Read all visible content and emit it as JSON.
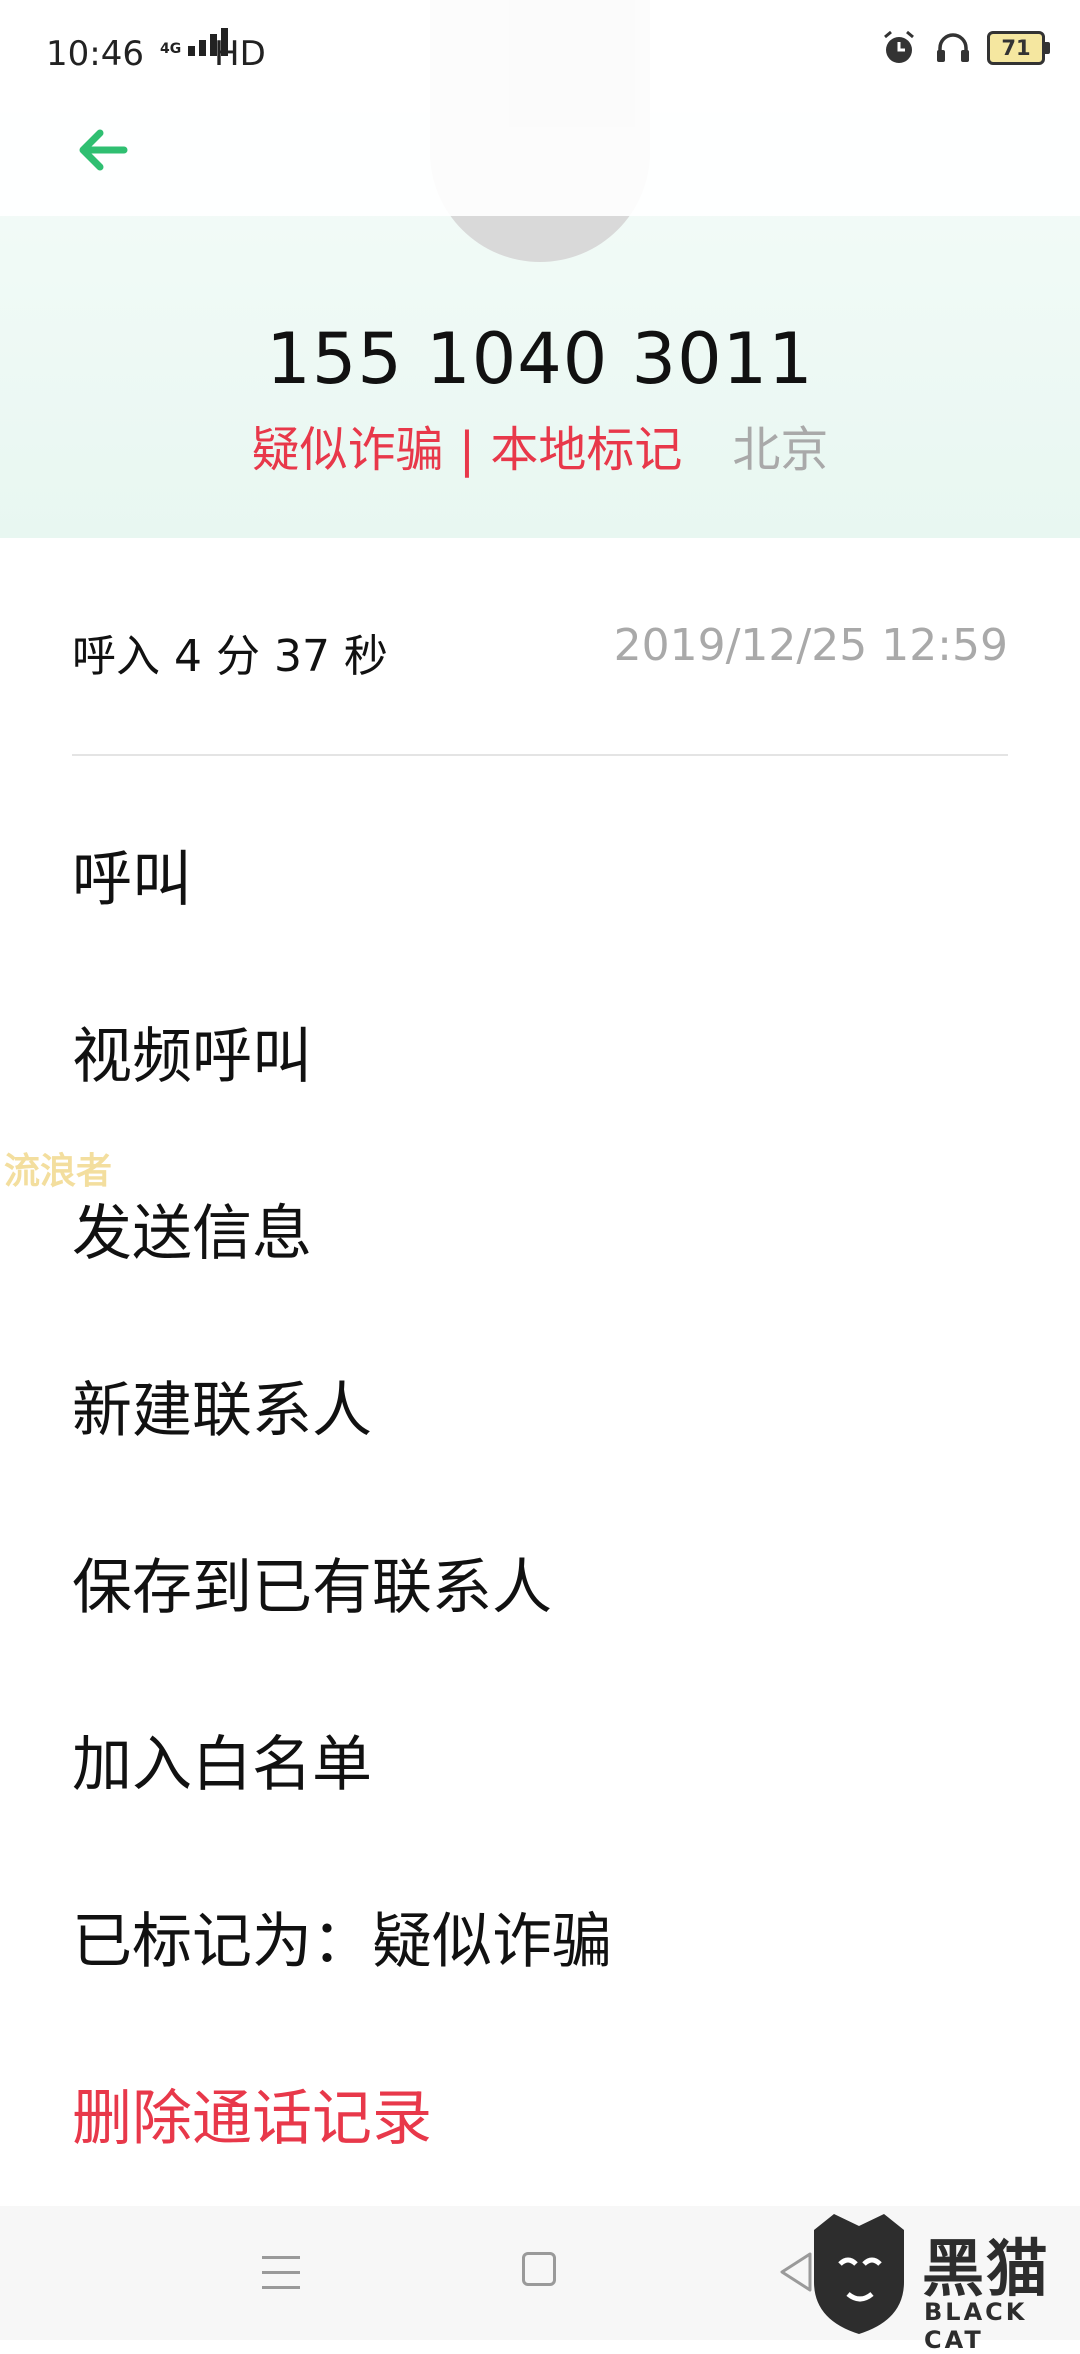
{
  "status_bar": {
    "time": "10:46",
    "network_tag": "4G",
    "hd": "HD",
    "battery": "71"
  },
  "header": {
    "phone_number": "155 1040 3011",
    "tag": "疑似诈骗 | 本地标记",
    "location": "北京"
  },
  "call_record": {
    "type_duration": "呼入  4 分 37 秒",
    "datetime": "2019/12/25 12:59"
  },
  "menu": [
    {
      "label": "呼叫"
    },
    {
      "label": "视频呼叫"
    },
    {
      "label": "发送信息"
    },
    {
      "label": "新建联系人"
    },
    {
      "label": "保存到已有联系人"
    },
    {
      "label": "加入白名单"
    },
    {
      "label": "已标记为：疑似诈骗"
    },
    {
      "label": "删除通话记录"
    }
  ],
  "watermark": "流浪者",
  "logo": {
    "text": "黑猫",
    "sub": "BLACK CAT"
  },
  "colors": {
    "accent": "#2fbf71",
    "danger": "#e8384a",
    "muted": "#a9a9a9"
  },
  "icons": {
    "back": "arrow-left-icon",
    "alarm": "alarm-icon",
    "headset": "headset-icon",
    "nav_menu": "menu-icon",
    "nav_home": "home-icon",
    "nav_back": "triangle-back-icon"
  }
}
